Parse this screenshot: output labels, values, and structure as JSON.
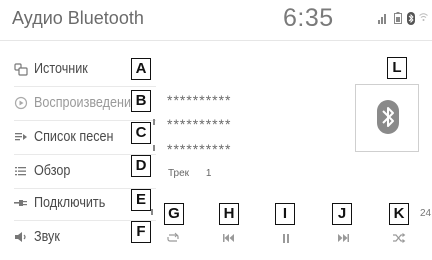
{
  "header": {
    "title": "Аудио Bluetooth",
    "clock": "6:35"
  },
  "sidebar": {
    "items": [
      {
        "label": "Источник",
        "icon": "source-icon",
        "dim": false
      },
      {
        "label": "Воспроизведение",
        "icon": "play-circle-icon",
        "dim": true
      },
      {
        "label": "Список песен",
        "icon": "playlist-icon",
        "dim": false
      },
      {
        "label": "Обзор",
        "icon": "browse-list-icon",
        "dim": false
      },
      {
        "label": "Подключить",
        "icon": "connect-icon",
        "dim": false
      },
      {
        "label": "Звук",
        "icon": "speaker-icon",
        "dim": false
      }
    ]
  },
  "now_playing": {
    "line1": "**********",
    "line2": "**********",
    "line3": "**********",
    "track_label": "Трек",
    "track_number": "1",
    "time_tail": "24"
  },
  "callouts": {
    "a": "A",
    "b": "B",
    "c": "C",
    "d": "D",
    "e": "E",
    "f": "F",
    "g": "G",
    "h": "H",
    "i": "I",
    "j": "J",
    "k": "K",
    "l": "L"
  },
  "controls": [
    {
      "name": "repeat",
      "icon": "repeat-icon"
    },
    {
      "name": "previous",
      "icon": "previous-track-icon"
    },
    {
      "name": "pause",
      "icon": "pause-icon"
    },
    {
      "name": "next",
      "icon": "next-track-icon"
    },
    {
      "name": "shuffle",
      "icon": "shuffle-icon"
    }
  ],
  "colors": {
    "text": "#4a4a4a",
    "dim_text": "#9a9a9a",
    "icon": "#8a8a8a",
    "callout_border": "#111111"
  }
}
